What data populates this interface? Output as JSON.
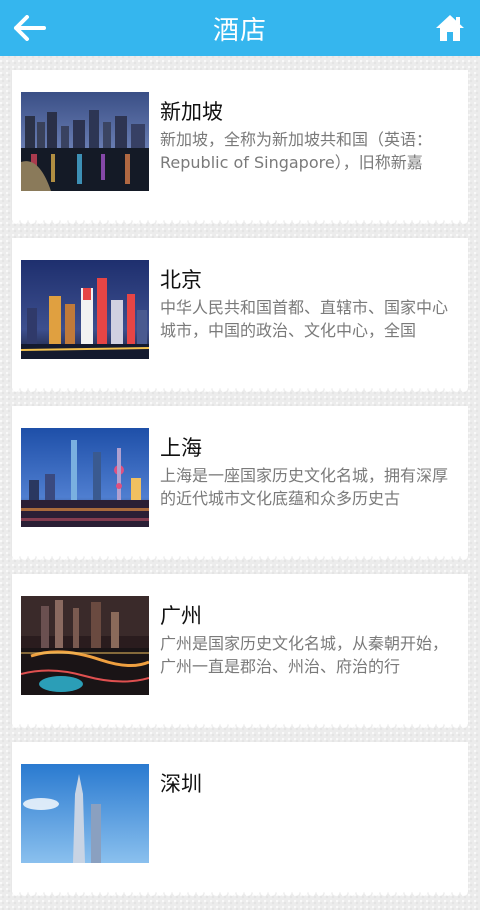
{
  "header": {
    "title": "酒店",
    "back_icon": "back-arrow-icon",
    "home_icon": "home-icon",
    "bg_color": "#35b6ee"
  },
  "cities": [
    {
      "name": "新加坡",
      "desc": "新加坡，全称为新加坡共和国（英语：Republic of Singapore），旧称新嘉"
    },
    {
      "name": "北京",
      "desc": "中华人民共和国首都、直辖市、国家中心城市，中国的政治、文化中心，全国"
    },
    {
      "name": "上海",
      "desc": "上海是一座国家历史文化名城，拥有深厚的近代城市文化底蕴和众多历史古"
    },
    {
      "name": "广州",
      "desc": "广州是国家历史文化名城，从秦朝开始，广州一直是郡治、州治、府治的行"
    },
    {
      "name": "深圳",
      "desc": ""
    }
  ]
}
